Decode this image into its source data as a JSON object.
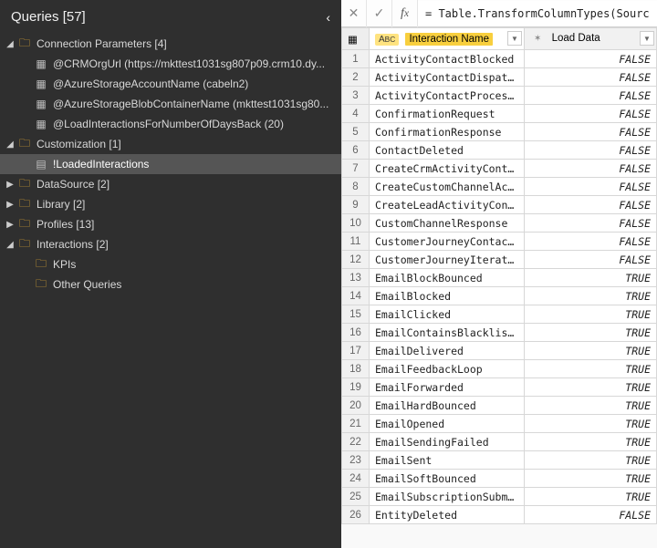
{
  "sidebar": {
    "title": "Queries [57]",
    "tree": [
      {
        "kind": "folder",
        "arrow": "down",
        "indent": 0,
        "label": "Connection Parameters [4]"
      },
      {
        "kind": "param",
        "arrow": "none",
        "indent": 1,
        "label": "@CRMOrgUrl (https://mkttest1031sg807p09.crm10.dy..."
      },
      {
        "kind": "param",
        "arrow": "none",
        "indent": 1,
        "label": "@AzureStorageAccountName (cabeln2)"
      },
      {
        "kind": "param",
        "arrow": "none",
        "indent": 1,
        "label": "@AzureStorageBlobContainerName (mkttest1031sg80..."
      },
      {
        "kind": "param",
        "arrow": "none",
        "indent": 1,
        "label": "@LoadInteractionsForNumberOfDaysBack (20)"
      },
      {
        "kind": "folder",
        "arrow": "down",
        "indent": 0,
        "label": "Customization [1]"
      },
      {
        "kind": "file",
        "arrow": "none",
        "indent": 1,
        "label": "!LoadedInteractions",
        "selected": true
      },
      {
        "kind": "folder",
        "arrow": "right",
        "indent": 0,
        "label": "DataSource [2]"
      },
      {
        "kind": "folder",
        "arrow": "right",
        "indent": 0,
        "label": "Library [2]"
      },
      {
        "kind": "folder",
        "arrow": "right",
        "indent": 0,
        "label": "Profiles [13]"
      },
      {
        "kind": "folder",
        "arrow": "down",
        "indent": 0,
        "label": "Interactions [2]"
      },
      {
        "kind": "folder-empty",
        "arrow": "none",
        "indent": 1,
        "label": "KPIs"
      },
      {
        "kind": "folder-empty",
        "arrow": "none",
        "indent": 1,
        "label": "Other Queries"
      }
    ]
  },
  "formula": "= Table.TransformColumnTypes(Source,{{",
  "columns": {
    "corner_icon": "▦",
    "col1": {
      "type": "ABC",
      "label": "Interaction Name"
    },
    "col2": {
      "type": "fx",
      "label": "Load Data"
    }
  },
  "rows": [
    {
      "n": 1,
      "name": "ActivityContactBlocked",
      "val": "FALSE"
    },
    {
      "n": 2,
      "name": "ActivityContactDispatc…",
      "val": "FALSE"
    },
    {
      "n": 3,
      "name": "ActivityContactProcess…",
      "val": "FALSE"
    },
    {
      "n": 4,
      "name": "ConfirmationRequest",
      "val": "FALSE"
    },
    {
      "n": 5,
      "name": "ConfirmationResponse",
      "val": "FALSE"
    },
    {
      "n": 6,
      "name": "ContactDeleted",
      "val": "FALSE"
    },
    {
      "n": 7,
      "name": "CreateCrmActivityConta…",
      "val": "FALSE"
    },
    {
      "n": 8,
      "name": "CreateCustomChannelAct…",
      "val": "FALSE"
    },
    {
      "n": 9,
      "name": "CreateLeadActivityCont…",
      "val": "FALSE"
    },
    {
      "n": 10,
      "name": "CustomChannelResponse",
      "val": "FALSE"
    },
    {
      "n": 11,
      "name": "CustomerJourneyContact…",
      "val": "FALSE"
    },
    {
      "n": 12,
      "name": "CustomerJourneyIterati…",
      "val": "FALSE"
    },
    {
      "n": 13,
      "name": "EmailBlockBounced",
      "val": "TRUE"
    },
    {
      "n": 14,
      "name": "EmailBlocked",
      "val": "TRUE"
    },
    {
      "n": 15,
      "name": "EmailClicked",
      "val": "TRUE"
    },
    {
      "n": 16,
      "name": "EmailContainsBlacklist…",
      "val": "TRUE"
    },
    {
      "n": 17,
      "name": "EmailDelivered",
      "val": "TRUE"
    },
    {
      "n": 18,
      "name": "EmailFeedbackLoop",
      "val": "TRUE"
    },
    {
      "n": 19,
      "name": "EmailForwarded",
      "val": "TRUE"
    },
    {
      "n": 20,
      "name": "EmailHardBounced",
      "val": "TRUE"
    },
    {
      "n": 21,
      "name": "EmailOpened",
      "val": "TRUE"
    },
    {
      "n": 22,
      "name": "EmailSendingFailed",
      "val": "TRUE"
    },
    {
      "n": 23,
      "name": "EmailSent",
      "val": "TRUE"
    },
    {
      "n": 24,
      "name": "EmailSoftBounced",
      "val": "TRUE"
    },
    {
      "n": 25,
      "name": "EmailSubscriptionSubmit",
      "val": "TRUE"
    },
    {
      "n": 26,
      "name": "EntityDeleted",
      "val": "FALSE"
    }
  ]
}
